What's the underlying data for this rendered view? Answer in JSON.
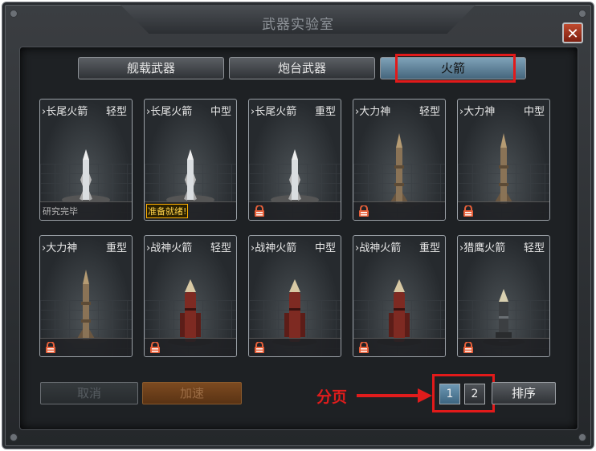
{
  "window": {
    "title": "武器实验室"
  },
  "tabs": [
    {
      "label": "舰载武器"
    },
    {
      "label": "炮台武器"
    },
    {
      "label": "火箭"
    }
  ],
  "cards": [
    {
      "name": "长尾火箭",
      "type": "轻型",
      "status": "研究完毕"
    },
    {
      "name": "长尾火箭",
      "type": "中型",
      "status": "准备就绪!"
    },
    {
      "name": "长尾火箭",
      "type": "重型",
      "status": "locked"
    },
    {
      "name": "大力神",
      "type": "轻型",
      "status": "locked"
    },
    {
      "name": "大力神",
      "type": "中型",
      "status": "locked"
    },
    {
      "name": "大力神",
      "type": "重型",
      "status": "locked"
    },
    {
      "name": "战神火箭",
      "type": "轻型",
      "status": "locked"
    },
    {
      "name": "战神火箭",
      "type": "中型",
      "status": "locked"
    },
    {
      "name": "战神火箭",
      "type": "重型",
      "status": "locked"
    },
    {
      "name": "猎鹰火箭",
      "type": "轻型",
      "status": "locked"
    }
  ],
  "actions": {
    "cancel": "取消",
    "speedup": "加速",
    "sort": "排序"
  },
  "pagination": {
    "pages": [
      "1",
      "2"
    ],
    "current": "1"
  },
  "annotation": {
    "label": "分页"
  },
  "colors": {
    "highlight": "#e21a1a",
    "active_tab": "#6f93ab",
    "lock": "#e8603a"
  }
}
